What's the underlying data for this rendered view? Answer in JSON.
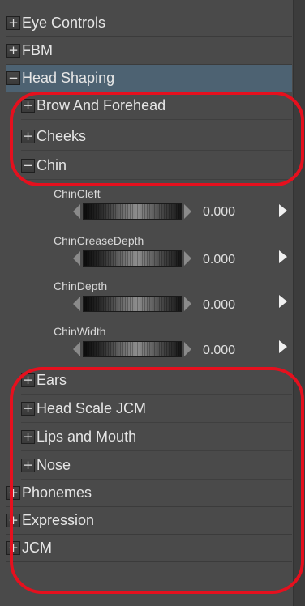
{
  "tree": {
    "top_items": [
      {
        "label": "Eye Controls",
        "toggle": "+"
      },
      {
        "label": "FBM",
        "toggle": "+"
      },
      {
        "label": "Head Shaping",
        "toggle": "−"
      }
    ],
    "head_children_top": [
      {
        "label": "Brow And Forehead",
        "toggle": "+"
      },
      {
        "label": "Cheeks",
        "toggle": "+"
      },
      {
        "label": "Chin",
        "toggle": "−"
      }
    ],
    "chin_properties": [
      {
        "name": "ChinCleft",
        "value": "0.000"
      },
      {
        "name": "ChinCreaseDepth",
        "value": "0.000"
      },
      {
        "name": "ChinDepth",
        "value": "0.000"
      },
      {
        "name": "ChinWidth",
        "value": "0.000"
      }
    ],
    "head_children_bottom": [
      {
        "label": "Ears",
        "toggle": "+"
      },
      {
        "label": "Head Scale JCM",
        "toggle": "+"
      },
      {
        "label": "Lips and Mouth",
        "toggle": "+"
      },
      {
        "label": "Nose",
        "toggle": "+"
      }
    ],
    "bottom_items": [
      {
        "label": "Phonemes",
        "toggle": "+"
      },
      {
        "label": "Expression",
        "toggle": "+"
      },
      {
        "label": "JCM",
        "toggle": "+"
      }
    ]
  },
  "colors": {
    "panel_bg": "#4a4a4a",
    "selected_row": "#4d6272",
    "annotation": "#e5101e"
  },
  "icons": {
    "expand": "plus-icon",
    "collapse": "minus-icon",
    "slider_left": "arrow-left-icon",
    "slider_right": "arrow-right-icon",
    "play": "play-icon"
  }
}
